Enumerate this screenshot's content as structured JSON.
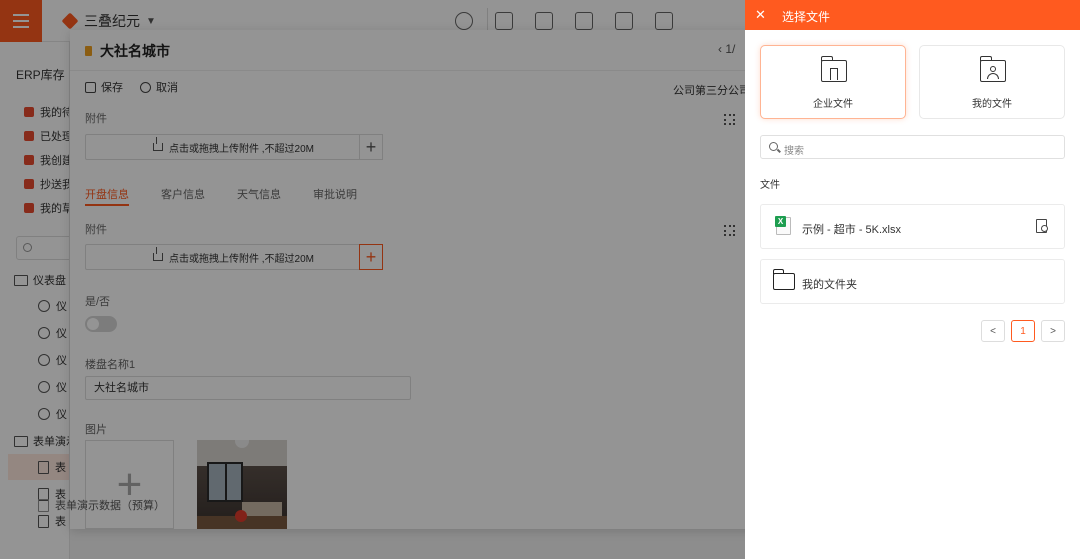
{
  "app": {
    "name": "三叠纪元"
  },
  "sidebar": {
    "title": "ERP库存",
    "items": [
      {
        "label": "我的待办"
      },
      {
        "label": "已处理"
      },
      {
        "label": "我创建的"
      },
      {
        "label": "抄送我"
      },
      {
        "label": "我的草稿"
      }
    ],
    "groups": [
      {
        "label": "仪表盘"
      },
      {
        "label": "表单演示"
      }
    ],
    "dashboard_items": [
      "仪",
      "仪",
      "仪",
      "仪",
      "仪"
    ],
    "form_items": [
      "表",
      "表",
      "表"
    ],
    "bottom_item": "表单演示数据（预算）"
  },
  "modal": {
    "title": "大社名城市",
    "pager_text": "1/",
    "actions": {
      "save": "保存",
      "cancel": "取消"
    },
    "company": "公司第三分公司",
    "attachment_label": "附件",
    "upload_hint": "点击或拖拽上传附件 ,不超过20M",
    "tabs": [
      {
        "label": "开盘信息",
        "active": true
      },
      {
        "label": "客户信息",
        "active": false
      },
      {
        "label": "天气信息",
        "active": false
      },
      {
        "label": "审批说明",
        "active": false
      }
    ],
    "attachment_label_2": "附件",
    "upload_hint_2": "点击或拖拽上传附件 ,不超过20M",
    "yes_no_label": "是/否",
    "yes_no_value": false,
    "building_name_label": "楼盘名称1",
    "building_name_value": "大社名城市",
    "image_label": "图片"
  },
  "drawer": {
    "title": "选择文件",
    "close_icon": "close-icon",
    "cards": [
      {
        "label": "企业文件",
        "icon": "enterprise-folder-icon",
        "selected": true
      },
      {
        "label": "我的文件",
        "icon": "user-folder-icon",
        "selected": false
      }
    ],
    "search_placeholder": "搜索",
    "section_title": "文件",
    "files": [
      {
        "name": "示例 - 超市 - 5K.xlsx",
        "type": "xlsx"
      },
      {
        "name": "我的文件夹",
        "type": "folder"
      }
    ],
    "pagination": {
      "prev": "<",
      "current": "1",
      "next": ">"
    }
  },
  "colors": {
    "accent": "#ff5a1f",
    "overlay": "rgba(0,0,0,0.42)"
  }
}
